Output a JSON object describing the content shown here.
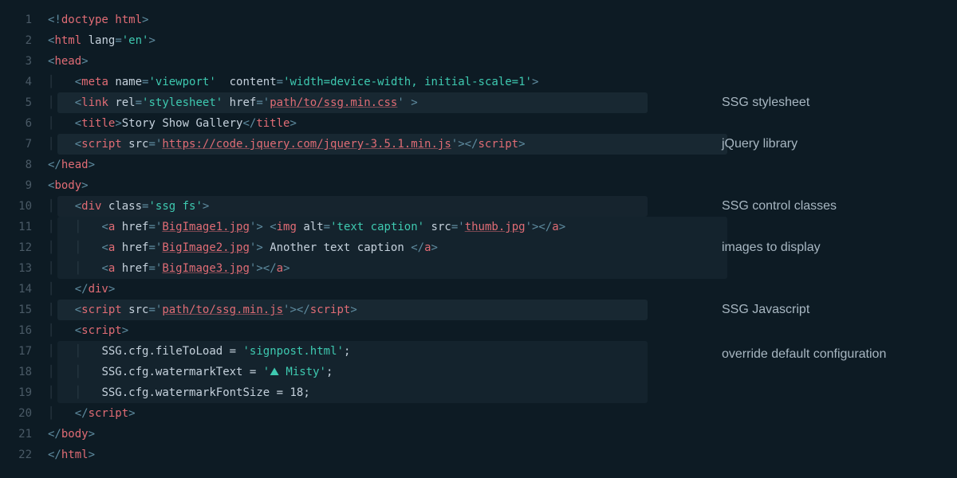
{
  "lineCount": 22,
  "code": {
    "doctype": "doctype html",
    "htmlTag": "html",
    "langAttr": "lang",
    "langVal": "'en'",
    "headTag": "head",
    "metaTag": "meta",
    "metaName": "name",
    "metaNameVal": "'viewport'",
    "metaContent": "content",
    "metaContentVal": "'width=device-width, initial-scale=1'",
    "linkTag": "link",
    "relAttr": "rel",
    "relVal": "'stylesheet'",
    "hrefAttr": "href",
    "cssHref": "path/to/ssg.min.css",
    "titleTag": "title",
    "titleText": "Story Show Gallery",
    "scriptTag": "script",
    "srcAttr": "src",
    "jqueryUrl": "https://code.jquery.com/jquery-3.5.1.min.js",
    "bodyTag": "body",
    "divTag": "div",
    "classAttr": "class",
    "classVal": "'ssg fs'",
    "aTag": "a",
    "img1": "BigImage1.jpg",
    "img2": "BigImage2.jpg",
    "img3": "BigImage3.jpg",
    "imgTag": "img",
    "altAttr": "alt",
    "altVal": "'text caption'",
    "thumbSrc": "thumb.jpg",
    "anotherCaption": " Another text caption ",
    "ssgJs": "path/to/ssg.min.js",
    "jsObj": "SSG",
    "jsCfg": "cfg",
    "fileToLoad": "fileToLoad",
    "fileToLoadVal": "'signpost.html'",
    "watermarkText": "watermarkText",
    "watermarkTextVal": "'⛰ Misty'",
    "watermarkFontSize": "watermarkFontSize",
    "watermarkFontSizeVal": "18"
  },
  "annotations": {
    "stylesheet": "SSG stylesheet",
    "jquery": "jQuery library",
    "controlClasses": "SSG control classes",
    "images": "images to display",
    "javascript": "SSG Javascript",
    "override": "override default configuration"
  }
}
